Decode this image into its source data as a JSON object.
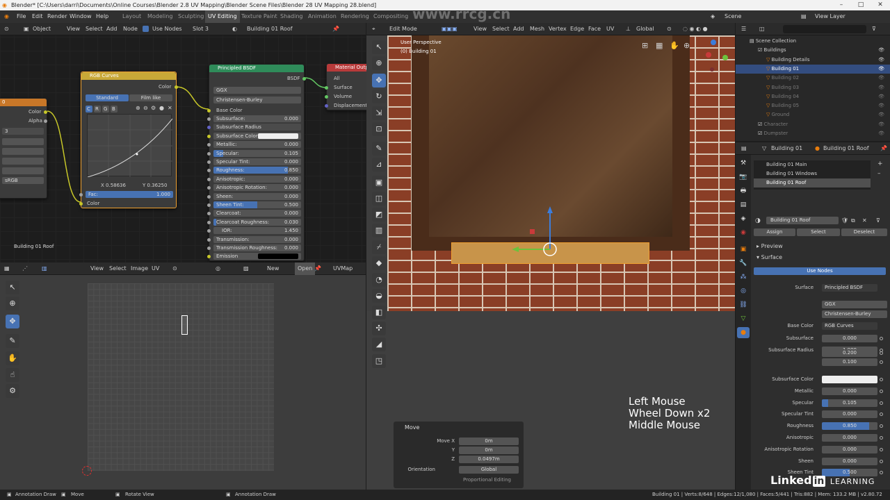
{
  "window": {
    "title": "Blender* [C:\\Users\\darri\\Documents\\Online Courses\\Blender 2.8 UV Mapping\\Blender Scene Files\\Blender 28 UV Mapping 28.blend]"
  },
  "watermark": "www.rrcg.cn",
  "menu": {
    "items": [
      "File",
      "Edit",
      "Render",
      "Window",
      "Help"
    ]
  },
  "workspaces": [
    "Layout",
    "Modeling",
    "Sculpting",
    "UV Editing",
    "Texture Paint",
    "Shading",
    "Animation",
    "Rendering",
    "Compositing"
  ],
  "scene": {
    "label": "Scene",
    "view_layer": "View Layer"
  },
  "node_editor": {
    "header": {
      "mode": "Object",
      "view": "View",
      "select": "Select",
      "add": "Add",
      "node": "Node",
      "use_nodes": "Use Nodes",
      "slot": "Slot 3",
      "material": "Building 01 Roof"
    },
    "footer_label": "Building 01 Roof",
    "left_node": {
      "header": "0",
      "outputs": [
        "Color",
        "Alpha"
      ],
      "count": "3",
      "colorspace": "sRGB"
    },
    "rgb_curves": {
      "title": "RGB Curves",
      "output": "Color",
      "tabs": [
        "Standard",
        "Film like"
      ],
      "channels": [
        "C",
        "R",
        "G",
        "B"
      ],
      "x": "X 0.58636",
      "y": "Y 0.36250",
      "fac_label": "Fac:",
      "fac_value": "1.000",
      "fac_fraction": 1.0,
      "input": "Color"
    },
    "principled": {
      "title": "Principled BSDF",
      "output": "BSDF",
      "distribution": "GGX",
      "subsurface_method": "Christensen-Burley",
      "base_color": "Base Color",
      "rows": [
        {
          "label": "Subsurface:",
          "value": "0.000",
          "fill": 0
        },
        {
          "label": "Subsurface Radius",
          "value": "",
          "fill": 0
        },
        {
          "label": "Subsurface Color",
          "value": "",
          "fill": 0
        },
        {
          "label": "Metallic:",
          "value": "0.000",
          "fill": 0
        },
        {
          "label": "Specular:",
          "value": "0.105",
          "fill": 0.105
        },
        {
          "label": "Specular Tint:",
          "value": "0.000",
          "fill": 0
        },
        {
          "label": "Roughness:",
          "value": "0.850",
          "fill": 0.85
        },
        {
          "label": "Anisotropic:",
          "value": "0.000",
          "fill": 0
        },
        {
          "label": "Anisotropic Rotation:",
          "value": "0.000",
          "fill": 0
        },
        {
          "label": "Sheen:",
          "value": "0.000",
          "fill": 0
        },
        {
          "label": "Sheen Tint:",
          "value": "0.500",
          "fill": 0.5
        },
        {
          "label": "Clearcoat:",
          "value": "0.000",
          "fill": 0
        },
        {
          "label": "Clearcoat Roughness:",
          "value": "0.030",
          "fill": 0.03
        },
        {
          "label": "IOR:",
          "value": "1.450",
          "fill": 0
        },
        {
          "label": "Transmission:",
          "value": "0.000",
          "fill": 0
        },
        {
          "label": "Transmission Roughness:",
          "value": "0.000",
          "fill": 0
        },
        {
          "label": "Emission",
          "value": "",
          "fill": 0
        }
      ]
    },
    "material_output": {
      "title": "Material Output",
      "target": "All",
      "inputs": [
        "Surface",
        "Volume",
        "Displacement"
      ]
    }
  },
  "uv_editor": {
    "header": {
      "view": "View",
      "select": "Select",
      "image": "Image",
      "uv": "UV",
      "new": "New",
      "open": "Open",
      "uvmap": "UVMap"
    }
  },
  "viewport": {
    "header": {
      "mode": "Edit Mode",
      "view": "View",
      "select": "Select",
      "add": "Add",
      "mesh": "Mesh",
      "vertex": "Vertex",
      "edge": "Edge",
      "face": "Face",
      "uv": "UV",
      "orientation": "Global"
    },
    "info_line1": "User Perspective",
    "info_line2": "(0) Building 01",
    "overlay_lines": [
      "Left Mouse",
      "Wheel Down x2",
      "Middle Mouse"
    ],
    "operator": {
      "title": "Move",
      "move_x_label": "Move X",
      "move_x": "0m",
      "y_label": "Y",
      "y": "0m",
      "z_label": "Z",
      "z": "0.0497m",
      "orientation_label": "Orientation",
      "orientation": "Global",
      "proportional": "Proportional Editing"
    }
  },
  "outliner": {
    "items": [
      {
        "name": "Scene Collection",
        "indent": 0,
        "selected": false,
        "dim": false
      },
      {
        "name": "Buildings",
        "indent": 1,
        "selected": false,
        "dim": false
      },
      {
        "name": "Building Details",
        "indent": 2,
        "selected": false,
        "dim": false
      },
      {
        "name": "Building 01",
        "indent": 2,
        "selected": true,
        "dim": false
      },
      {
        "name": "Building 02",
        "indent": 2,
        "selected": false,
        "dim": true
      },
      {
        "name": "Building 03",
        "indent": 2,
        "selected": false,
        "dim": true
      },
      {
        "name": "Building 04",
        "indent": 2,
        "selected": false,
        "dim": true
      },
      {
        "name": "Building 05",
        "indent": 2,
        "selected": false,
        "dim": true
      },
      {
        "name": "Ground",
        "indent": 2,
        "selected": false,
        "dim": true
      },
      {
        "name": "Character",
        "indent": 1,
        "selected": false,
        "dim": true
      },
      {
        "name": "Dumpster",
        "indent": 1,
        "selected": false,
        "dim": true
      }
    ]
  },
  "properties": {
    "object": "Building 01",
    "material": "Building 01 Roof",
    "slots": [
      "Building 01 Main",
      "Building 01 Windows",
      "Building 01 Roof"
    ],
    "material_field": "Building 01 Roof",
    "assign": "Assign",
    "select": "Select",
    "deselect": "Deselect",
    "preview": "Preview",
    "surface_section": "Surface",
    "use_nodes": "Use Nodes",
    "surface_label": "Surface",
    "surface_value": "Principled BSDF",
    "distribution": "GGX",
    "subsurface_method": "Christensen-Burley",
    "base_color_label": "Base Color",
    "base_color_value": "RGB Curves",
    "rows": [
      {
        "label": "Subsurface",
        "value": "0.000",
        "fill": 0
      },
      {
        "label": "Subsurface Radius",
        "value": "1.000",
        "fill": 0
      },
      {
        "label": "",
        "value": "0.200",
        "fill": 0
      },
      {
        "label": "",
        "value": "0.100",
        "fill": 0
      },
      {
        "label": "Subsurface Color",
        "value": "",
        "fill": 0
      },
      {
        "label": "Metallic",
        "value": "0.000",
        "fill": 0
      },
      {
        "label": "Specular",
        "value": "0.105",
        "fill": 0.105
      },
      {
        "label": "Specular Tint",
        "value": "0.000",
        "fill": 0
      },
      {
        "label": "Roughness",
        "value": "0.850",
        "fill": 0.85
      },
      {
        "label": "Anisotropic",
        "value": "0.000",
        "fill": 0
      },
      {
        "label": "Anisotropic Rotation",
        "value": "0.000",
        "fill": 0
      },
      {
        "label": "Sheen",
        "value": "0.000",
        "fill": 0
      },
      {
        "label": "Sheen Tint",
        "value": "0.500",
        "fill": 0.5
      }
    ]
  },
  "statusbar": {
    "left": [
      "Annotation Draw",
      "Move",
      "Rotate View",
      "Annotation Draw"
    ],
    "right": "Building 01 | Verts:8/648 | Edges:12/1,080 | Faces:5/441 | Tris:882 | Mem: 133.2 MB | v2.80.72"
  },
  "branding": {
    "linkedin": "Linked",
    "in": "in",
    "learning": "LEARNING"
  },
  "colors": {
    "accent": "#4772b3",
    "selected_orange": "#f0a030",
    "node_header_curves": "#c8a838",
    "node_header_bsdf": "#2f8c5a",
    "node_header_output": "#b83a3a"
  }
}
